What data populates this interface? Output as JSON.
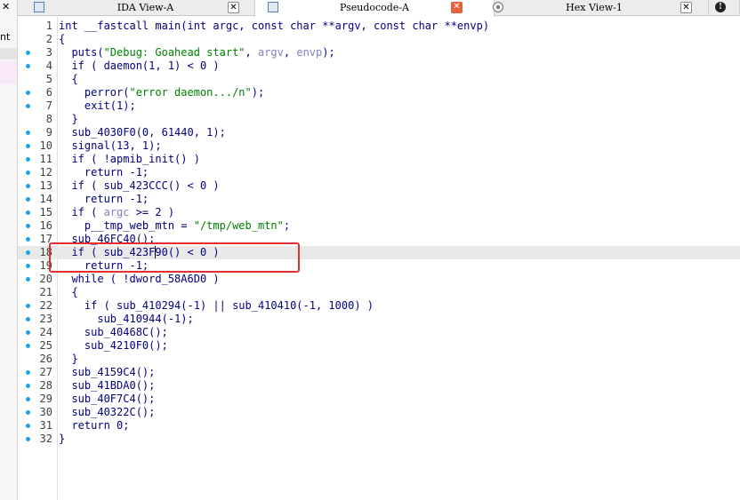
{
  "left_pane": {
    "label": "nt",
    "close_glyph": "✕"
  },
  "tabs": [
    {
      "title": "IDA View-A",
      "icon": "ida-view-icon",
      "close": "✕"
    },
    {
      "title": "Pseudocode-A",
      "icon": "pseudocode-icon",
      "close": "✕",
      "active": true
    },
    {
      "title": "Hex View-1",
      "icon": "hex-view-icon",
      "close": "✕"
    },
    {
      "title": "",
      "icon": "info-icon",
      "glyph": "!"
    }
  ],
  "editor": {
    "current_line": 18,
    "lines": [
      {
        "n": "1",
        "dot": false,
        "parts": [
          {
            "t": "int __fastcall main(int argc, const char **argv, const char **envp)",
            "c": "id"
          }
        ]
      },
      {
        "n": "2",
        "dot": false,
        "parts": [
          {
            "t": "{",
            "c": "id"
          }
        ]
      },
      {
        "n": "3",
        "dot": true,
        "parts": [
          {
            "t": "  puts(",
            "c": "id"
          },
          {
            "t": "\"Debug: Goahead start\"",
            "c": "str"
          },
          {
            "t": ", ",
            "c": "id"
          },
          {
            "t": "argv",
            "c": "arg"
          },
          {
            "t": ", ",
            "c": "id"
          },
          {
            "t": "envp",
            "c": "arg"
          },
          {
            "t": ");",
            "c": "id"
          }
        ]
      },
      {
        "n": "4",
        "dot": true,
        "parts": [
          {
            "t": "  if ( daemon(1, 1) < 0 )",
            "c": "id"
          }
        ]
      },
      {
        "n": "5",
        "dot": false,
        "parts": [
          {
            "t": "  {",
            "c": "id"
          }
        ]
      },
      {
        "n": "6",
        "dot": true,
        "parts": [
          {
            "t": "    perror(",
            "c": "id"
          },
          {
            "t": "\"error daemon.../n\"",
            "c": "str"
          },
          {
            "t": ");",
            "c": "id"
          }
        ]
      },
      {
        "n": "7",
        "dot": true,
        "parts": [
          {
            "t": "    exit(1);",
            "c": "id"
          }
        ]
      },
      {
        "n": "8",
        "dot": false,
        "parts": [
          {
            "t": "  }",
            "c": "id"
          }
        ]
      },
      {
        "n": "9",
        "dot": true,
        "parts": [
          {
            "t": "  sub_4030F0(0, 61440, 1);",
            "c": "id"
          }
        ]
      },
      {
        "n": "10",
        "dot": true,
        "parts": [
          {
            "t": "  signal(13, 1);",
            "c": "id"
          }
        ]
      },
      {
        "n": "11",
        "dot": true,
        "parts": [
          {
            "t": "  if ( !apmib_init() )",
            "c": "id"
          }
        ]
      },
      {
        "n": "12",
        "dot": true,
        "parts": [
          {
            "t": "    return -1;",
            "c": "id"
          }
        ]
      },
      {
        "n": "13",
        "dot": true,
        "parts": [
          {
            "t": "  if ( sub_423CCC() < 0 )",
            "c": "id"
          }
        ]
      },
      {
        "n": "14",
        "dot": true,
        "parts": [
          {
            "t": "    return -1;",
            "c": "id"
          }
        ]
      },
      {
        "n": "15",
        "dot": true,
        "parts": [
          {
            "t": "  if ( ",
            "c": "id"
          },
          {
            "t": "argc",
            "c": "arg"
          },
          {
            "t": " >= 2 )",
            "c": "id"
          }
        ]
      },
      {
        "n": "16",
        "dot": true,
        "parts": [
          {
            "t": "    p__tmp_web_mtn = ",
            "c": "id"
          },
          {
            "t": "\"/tmp/web_mtn\"",
            "c": "str"
          },
          {
            "t": ";",
            "c": "id"
          }
        ]
      },
      {
        "n": "17",
        "dot": true,
        "parts": [
          {
            "t": "  sub_46FC40();",
            "c": "id"
          }
        ]
      },
      {
        "n": "18",
        "dot": true,
        "parts": [
          {
            "t": "  if ( sub_423F90() < 0 )",
            "c": "id"
          }
        ]
      },
      {
        "n": "19",
        "dot": true,
        "parts": [
          {
            "t": "    return -1;",
            "c": "id"
          }
        ]
      },
      {
        "n": "20",
        "dot": true,
        "parts": [
          {
            "t": "  while ( !dword_58A6D0 )",
            "c": "id"
          }
        ]
      },
      {
        "n": "21",
        "dot": false,
        "parts": [
          {
            "t": "  {",
            "c": "id"
          }
        ]
      },
      {
        "n": "22",
        "dot": true,
        "parts": [
          {
            "t": "    if ( sub_410294(-1) || sub_410410(-1, 1000) )",
            "c": "id"
          }
        ]
      },
      {
        "n": "23",
        "dot": true,
        "parts": [
          {
            "t": "      sub_410944(-1);",
            "c": "id"
          }
        ]
      },
      {
        "n": "24",
        "dot": true,
        "parts": [
          {
            "t": "    sub_40468C();",
            "c": "id"
          }
        ]
      },
      {
        "n": "25",
        "dot": true,
        "parts": [
          {
            "t": "    sub_4210F0();",
            "c": "id"
          }
        ]
      },
      {
        "n": "26",
        "dot": false,
        "parts": [
          {
            "t": "  }",
            "c": "id"
          }
        ]
      },
      {
        "n": "27",
        "dot": true,
        "parts": [
          {
            "t": "  sub_4159C4();",
            "c": "id"
          }
        ]
      },
      {
        "n": "28",
        "dot": true,
        "parts": [
          {
            "t": "  sub_41BDA0();",
            "c": "id"
          }
        ]
      },
      {
        "n": "29",
        "dot": true,
        "parts": [
          {
            "t": "  sub_40F7C4();",
            "c": "id"
          }
        ]
      },
      {
        "n": "30",
        "dot": true,
        "parts": [
          {
            "t": "  sub_40322C();",
            "c": "id"
          }
        ]
      },
      {
        "n": "31",
        "dot": true,
        "parts": [
          {
            "t": "  return 0;",
            "c": "id"
          }
        ]
      },
      {
        "n": "32",
        "dot": true,
        "parts": [
          {
            "t": "}",
            "c": "id"
          }
        ]
      }
    ]
  },
  "colors": {
    "identifier": "#000080",
    "string": "#008000",
    "argument": "#8080c0",
    "breakpoint_dot": "#1aa3f0",
    "highlight_box": "#e03030",
    "active_tab_close": "#e8603c"
  }
}
